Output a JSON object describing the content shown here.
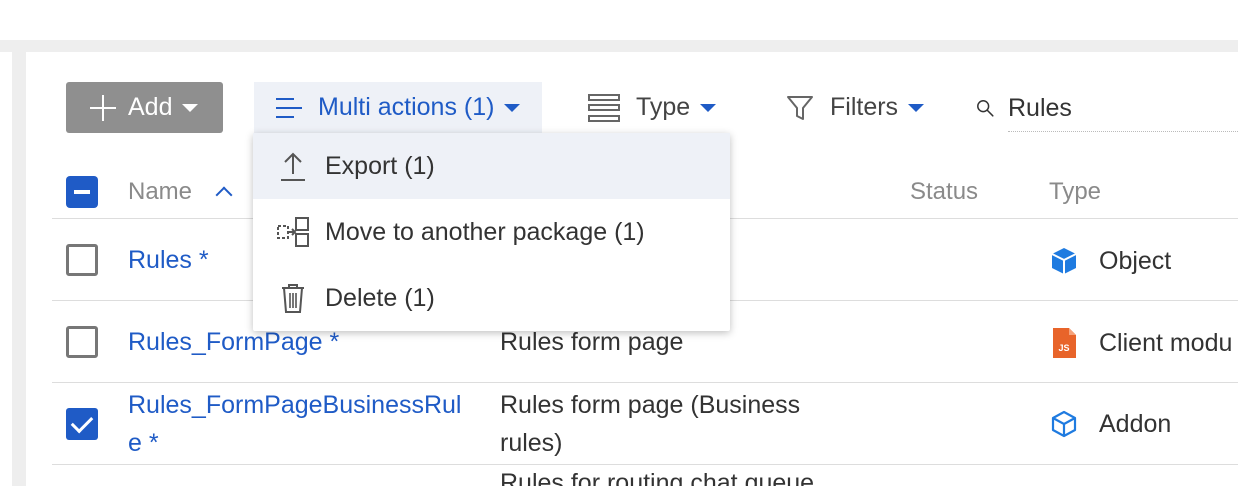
{
  "toolbar": {
    "add_label": "Add",
    "multi_actions_label": "Multi actions (1)",
    "type_label": "Type",
    "filters_label": "Filters",
    "search_value": "Rules"
  },
  "table": {
    "columns": {
      "name": "Name",
      "status": "Status",
      "type": "Type"
    },
    "rows": [
      {
        "name": "Rules *",
        "description": "",
        "type": "Object",
        "type_icon": "cube-icon",
        "checked": false
      },
      {
        "name": "Rules_FormPage *",
        "description": "Rules form page",
        "type": "Client modu",
        "type_icon": "js-file-icon",
        "checked": false
      },
      {
        "name_line1": "Rules_FormPageBusinessRul",
        "name_line2": "e *",
        "description_line1": "Rules form page (Business",
        "description_line2": "rules)",
        "type": "Addon",
        "type_icon": "cube-outline-icon",
        "checked": true
      },
      {
        "description": "Rules for routing chat queue"
      }
    ]
  },
  "dropdown": {
    "items": [
      {
        "label": "Export (1)",
        "icon": "upload-icon"
      },
      {
        "label": "Move to another package (1)",
        "icon": "move-package-icon"
      },
      {
        "label": "Delete (1)",
        "icon": "trash-icon"
      }
    ]
  },
  "colors": {
    "accent": "#1f5bc6",
    "add_button_bg": "#8f8f8f",
    "active_bg": "#eef1f7",
    "js_icon": "#e8642a"
  }
}
